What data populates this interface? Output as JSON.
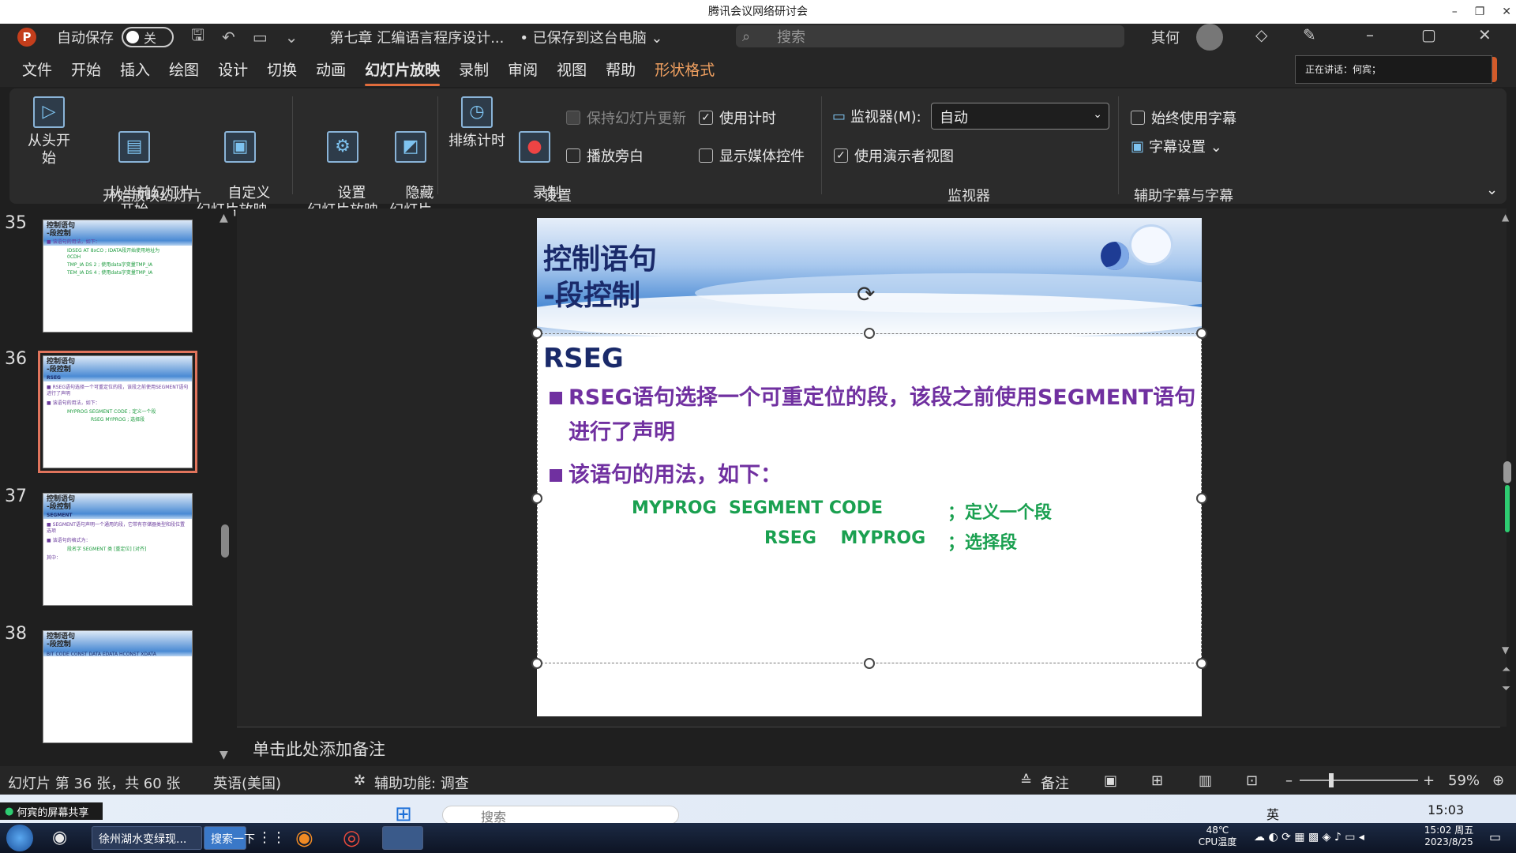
{
  "meeting": {
    "title": "腾讯会议网络研讨会",
    "min": "–",
    "restore": "❐",
    "close": "✕"
  },
  "titlebar": {
    "autosave_label": "自动保存",
    "autosave_state": "关",
    "doc_title": "第七章 汇编语言程序设计...",
    "save_status": "• 已保存到这台电脑 ⌄",
    "search_placeholder": "搜索",
    "user_name": "其何"
  },
  "tabs": [
    "文件",
    "开始",
    "插入",
    "绘图",
    "设计",
    "切换",
    "动画",
    "幻灯片放映",
    "录制",
    "审阅",
    "视图",
    "帮助",
    "形状格式"
  ],
  "speaker": "正在讲话：何宾；",
  "ribbon": {
    "from_beginning": "从头开始",
    "from_current": "从当前幻灯片\n开始",
    "custom_show": "自定义\n幻灯片放映 ⌄",
    "group_start": "开始放映幻灯片",
    "setup_show": "设置\n幻灯片放映",
    "hide_slide": "隐藏\n幻灯片",
    "rehearse": "排练计时",
    "record": "录制\n⌄",
    "keep_updated": "保持幻灯片更新",
    "play_narration": "播放旁白",
    "use_timings": "使用计时",
    "show_media": "显示媒体控件",
    "group_setup": "设置",
    "monitor_label": "监视器(M):",
    "monitor_value": "自动",
    "presenter_view": "使用演示者视图",
    "group_monitor": "监视器",
    "always_subtitles": "始终使用字幕",
    "subtitle_settings": "字幕设置 ⌄",
    "group_captions": "辅助字幕与字幕"
  },
  "thumbnails": [
    {
      "num": "35",
      "title": "控制语句\n-段控制",
      "lines": [
        "■ 该语句的用法，如下："
      ],
      "green": [
        "IDSEG AT 8xCO   ; IDATA段开始使用地址为0CDH",
        "TMP_IA   DS  2    ; 使用data字变量TMP_IA",
        "TEM_IA   DS  4    ; 使用data字变量TMP_IA"
      ]
    },
    {
      "num": "36",
      "title": "控制语句\n-段控制",
      "lines": [
        "RSEG",
        "■ RSEG语句选择一个可重定位的段，该段之前使用SEGMENT语句进行了声明",
        "■ 该语句的用法，如下："
      ],
      "green": [
        "MYPROG SEGMENT CODE   ; 定义一个段",
        "RSEG   MYPROG   ; 选择段"
      ]
    },
    {
      "num": "37",
      "title": "控制语句\n-段控制",
      "lines": [
        "SEGMENT",
        "■ SEGMENT语句声明一个通用的段，它带有存储器类型和段位置选项",
        "■ 该语句的格式为：",
        "其中："
      ],
      "green": [
        "段名字 SEGMENT 类 [重定位] [对齐]"
      ]
    },
    {
      "num": "38",
      "title": "控制语句\n-段控制",
      "lines": [
        "BIT  CODE  CONST  DATA  EDATA  HCONST  XDATA"
      ],
      "green": []
    }
  ],
  "slide": {
    "title": "控制语句\n-段控制",
    "heading": "RSEG",
    "bullet1": "RSEG语句选择一个可重定位的段，该段之前使用SEGMENT语句进行了声明",
    "bullet2": "该语句的用法，如下：",
    "code1": "MYPROG  SEGMENT CODE",
    "code1_comment": "；定义一个段",
    "code2": "RSEG    MYPROG",
    "code2_comment": "；选择段"
  },
  "notes_placeholder": "单击此处添加备注",
  "status": {
    "slide_info": "幻灯片 第 36 张，共 60 张",
    "language": "英语(美国)",
    "accessibility": "辅助功能: 调查",
    "notes_btn": "备注",
    "zoom": "59%",
    "zoom_fraction": 0.59
  },
  "taskbar": {
    "share_label": "何宾的屏幕共享",
    "search_placeholder": "搜索",
    "time_top": "15:03",
    "browser_item": "徐州湖水变绿现...",
    "search_btn": "搜索一下",
    "cpu_temp": "48℃\nCPU温度",
    "datetime": "15:02 周五\n2023/8/25",
    "ime": "英"
  },
  "colors": {
    "accent_orange": "#e06c3c",
    "purple_text": "#7030a0",
    "green_code": "#1aa050",
    "title_navy": "#1a2a6a"
  }
}
